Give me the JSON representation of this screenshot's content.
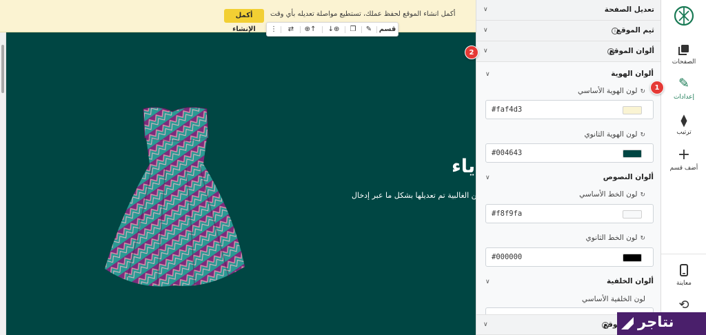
{
  "notice": {
    "text": "أكمل انشاء الموقع لحفظ عملك، تستطيع مواصلة تعديله بأي وقت",
    "button": "أكمل الإنشاء"
  },
  "toolbar": {
    "section_label": "قسم",
    "icons": [
      "pencil-icon",
      "copy-icon",
      "move-down-add-icon",
      "move-up-add-icon",
      "swap-icon",
      "more-icon"
    ]
  },
  "hero": {
    "title": "ياء",
    "description": "ولكن الغالبية تم تعديلها بشكل ما عبر إدخال",
    "image": "dress"
  },
  "settings": {
    "sections": {
      "edit_page": "تعديل الصفحة",
      "theme": "ثيم الموقع",
      "colors": "ألوان الموقع",
      "bottom": "خطوط الموقع"
    },
    "groups": {
      "identity": "ألوان الهوية",
      "text": "ألوان النصوص",
      "background": "ألوان الخلفية"
    },
    "fields": [
      {
        "label": "لون الهوية الأساسي",
        "value": "#faf4d3",
        "swatch": "#faf4d3"
      },
      {
        "label": "لون الهوية الثانوي",
        "value": "#004643",
        "swatch": "#004643"
      },
      {
        "label": "لون الخط الأساسي",
        "value": "#f8f9fa",
        "swatch": "#f8f9fa"
      },
      {
        "label": "لون الخط الثانوي",
        "value": "#000000",
        "swatch": "#000000"
      },
      {
        "label": "لون الخلفية الأساسي",
        "value": "",
        "swatch": "#ffffff"
      }
    ]
  },
  "nav": {
    "items": [
      {
        "label": "الصفحات",
        "icon": "pages-icon"
      },
      {
        "label": "إعدادات",
        "icon": "pencil-icon"
      },
      {
        "label": "ترتيب",
        "icon": "sort-icon"
      },
      {
        "label": "أضف قسم",
        "icon": "plus-icon"
      },
      {
        "label": "معاينة",
        "icon": "mobile-icon"
      },
      {
        "label": "",
        "icon": "history-icon"
      }
    ]
  },
  "badges": [
    "1",
    "2"
  ],
  "brand": {
    "name": "نتاجر"
  },
  "colors": {
    "accent": "#1a7a55",
    "canvas": "#004643",
    "notice": "#fbf3d2",
    "badge": "#e53935",
    "brand": "#4a1f6b"
  }
}
